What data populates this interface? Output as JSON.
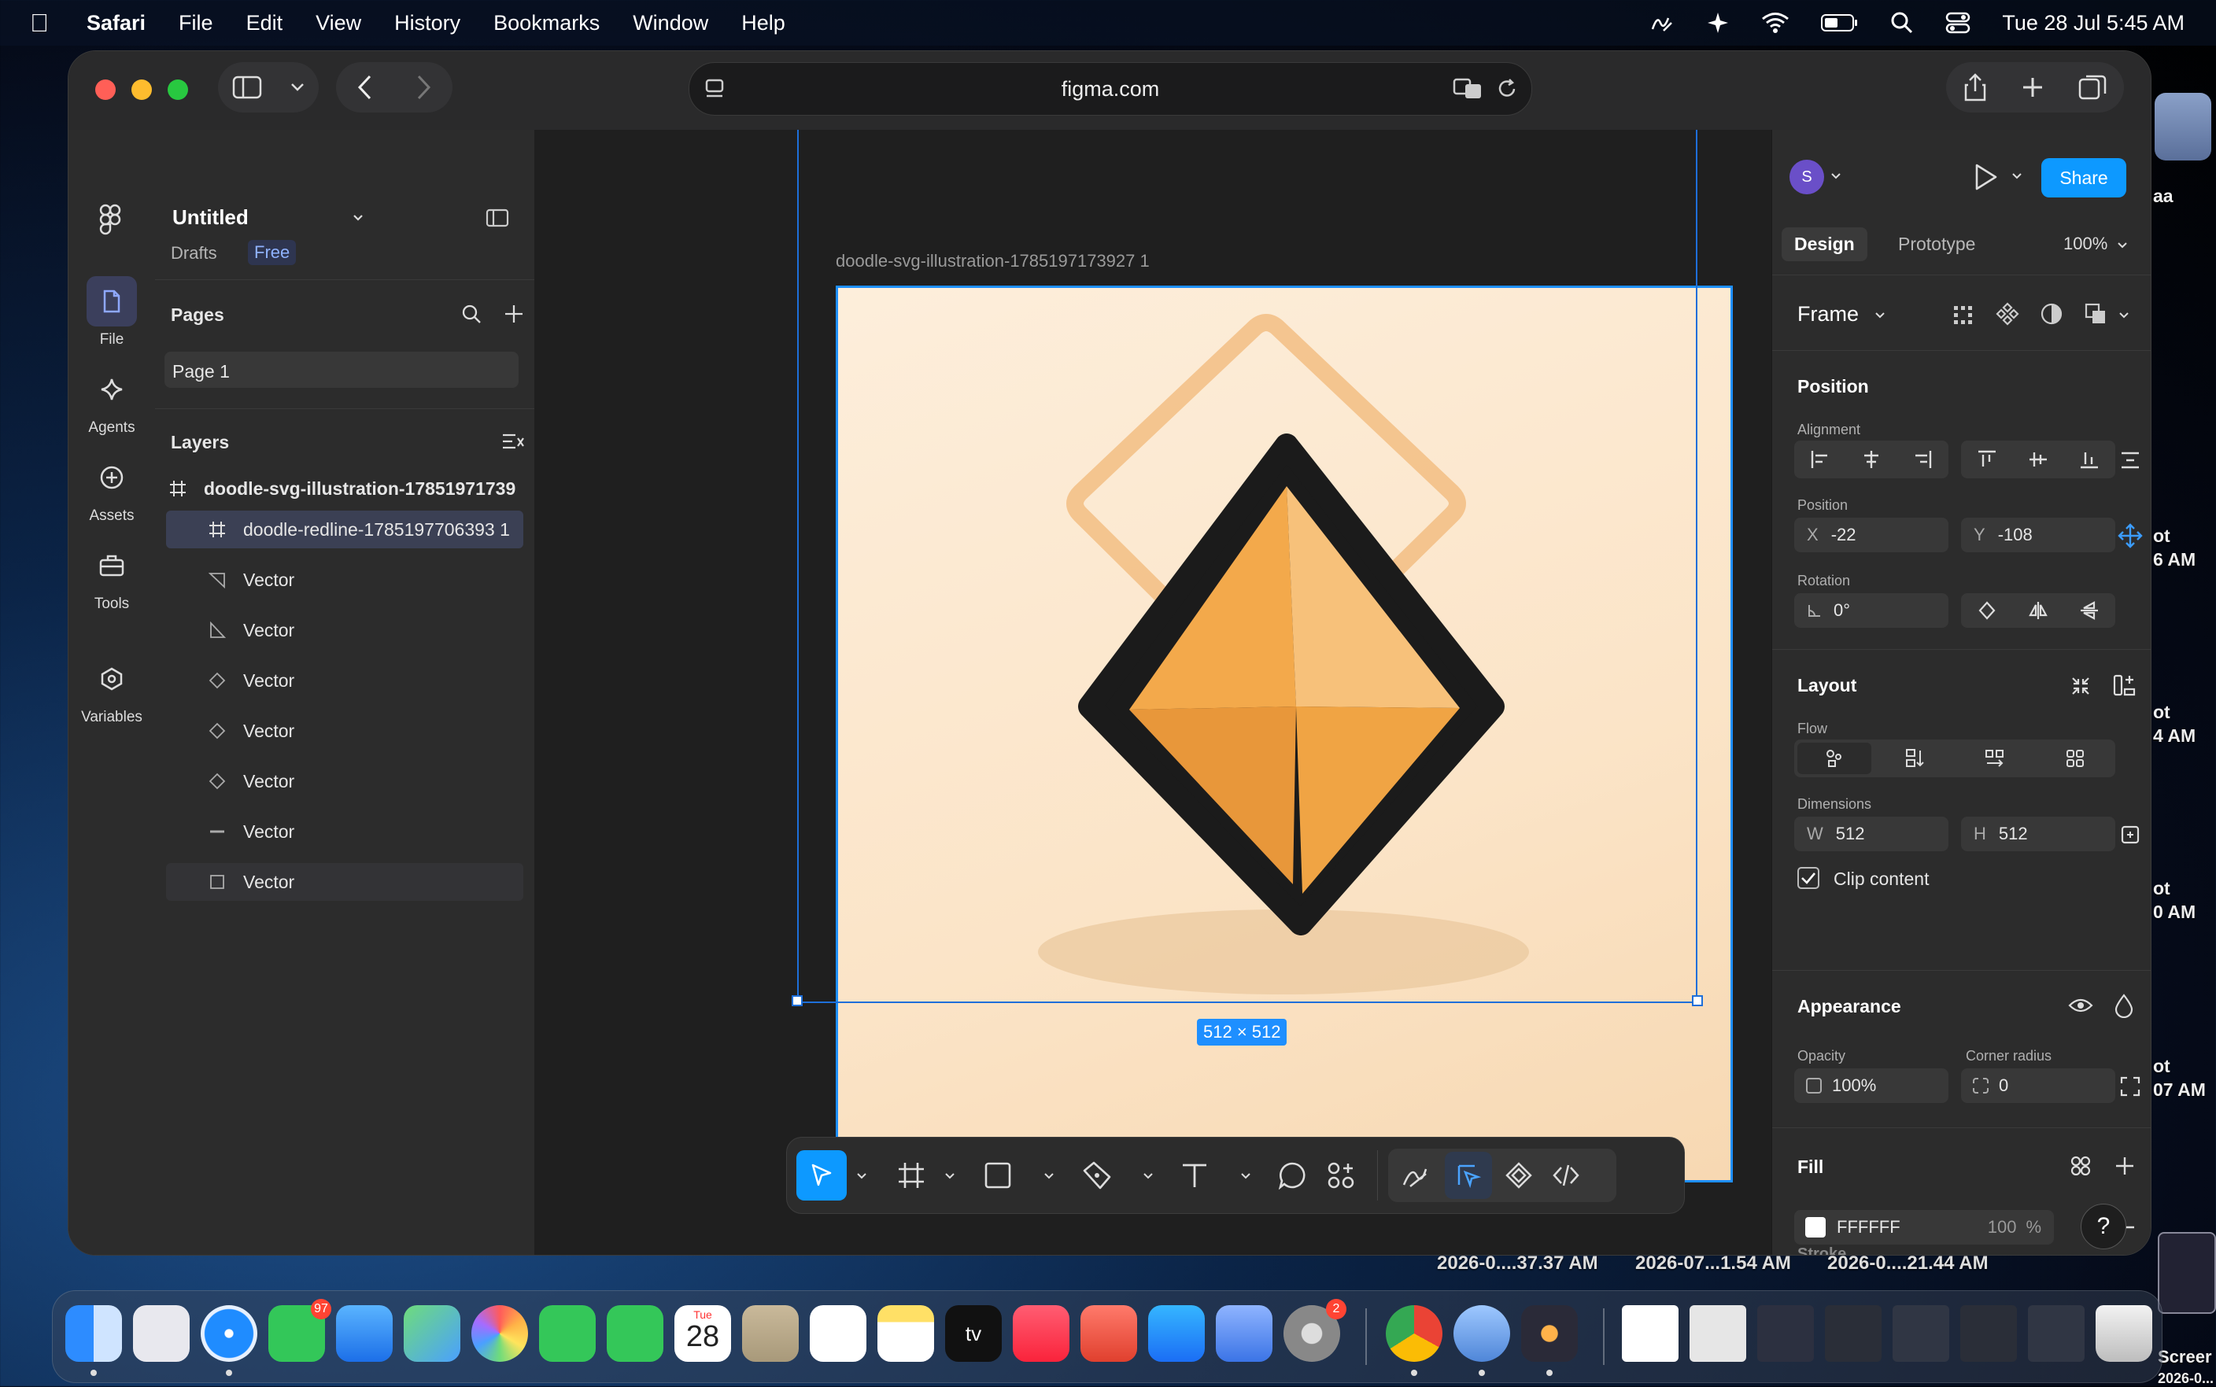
{
  "menubar": {
    "app": "Safari",
    "items": [
      "File",
      "Edit",
      "View",
      "History",
      "Bookmarks",
      "Window",
      "Help"
    ],
    "clock": "Tue 28 Jul  5:45 AM"
  },
  "browser": {
    "url": "figma.com"
  },
  "rail": {
    "items": [
      {
        "label": "File",
        "icon": "file-icon"
      },
      {
        "label": "Agents",
        "icon": "agents-icon"
      },
      {
        "label": "Assets",
        "icon": "assets-icon"
      },
      {
        "label": "Tools",
        "icon": "tools-icon"
      },
      {
        "label": "Variables",
        "icon": "variables-icon"
      }
    ]
  },
  "file": {
    "name": "Untitled",
    "location": "Drafts",
    "plan": "Free"
  },
  "pages": {
    "title": "Pages",
    "items": [
      "Page 1"
    ]
  },
  "layers": {
    "title": "Layers",
    "items": [
      {
        "name": "doodle-svg-illustration-17851971739",
        "icon": "frame-icon"
      },
      {
        "name": "doodle-redline-1785197706393 1",
        "icon": "frame-icon"
      },
      {
        "name": "Vector",
        "icon": "vector-icon"
      },
      {
        "name": "Vector",
        "icon": "vector-icon"
      },
      {
        "name": "Vector",
        "icon": "vector-diamond-icon"
      },
      {
        "name": "Vector",
        "icon": "vector-diamond-icon"
      },
      {
        "name": "Vector",
        "icon": "vector-diamond-icon"
      },
      {
        "name": "Vector",
        "icon": "line-icon"
      },
      {
        "name": "Vector",
        "icon": "rectangle-icon"
      }
    ]
  },
  "canvas": {
    "frame_label": "doodle-svg-illustration-1785197173927 1",
    "size_badge": "512 × 512"
  },
  "right": {
    "avatar": "S",
    "share": "Share",
    "tabs": [
      "Design",
      "Prototype"
    ],
    "zoom": "100%",
    "frame_title": "Frame",
    "position": {
      "title": "Position",
      "alignment": "Alignment",
      "position_label": "Position",
      "x_key": "X",
      "x": "-22",
      "y_key": "Y",
      "y": "-108",
      "rotation_label": "Rotation",
      "rotation": "0°"
    },
    "layout": {
      "title": "Layout",
      "flow": "Flow",
      "dimensions": "Dimensions",
      "w_key": "W",
      "w": "512",
      "h_key": "H",
      "h": "512",
      "clip": "Clip content"
    },
    "appearance": {
      "title": "Appearance",
      "opacity_label": "Opacity",
      "opacity": "100%",
      "radius_label": "Corner radius",
      "radius": "0"
    },
    "fill": {
      "title": "Fill",
      "hex": "FFFFFF",
      "opacity": "100",
      "unit": "%"
    },
    "stroke": {
      "title": "Stroke"
    }
  },
  "screenshots": [
    "2026-0....37.37 AM",
    "2026-07...1.54 AM",
    "2026-0....21.44 AM"
  ],
  "desktop_labels": [
    "aa",
    "ot",
    "6 AM",
    "ot",
    "4 AM",
    "ot",
    "0 AM",
    "ot",
    "07 AM",
    "Screer",
    "2026-0..."
  ],
  "dock": {
    "messages_badge": "97",
    "settings_badge": "2",
    "calendar_month": "Tue",
    "calendar_day": "28",
    "tv_label": "tv"
  },
  "colors": {
    "accent": "#0d99ff",
    "selection": "#1e6fd9"
  }
}
